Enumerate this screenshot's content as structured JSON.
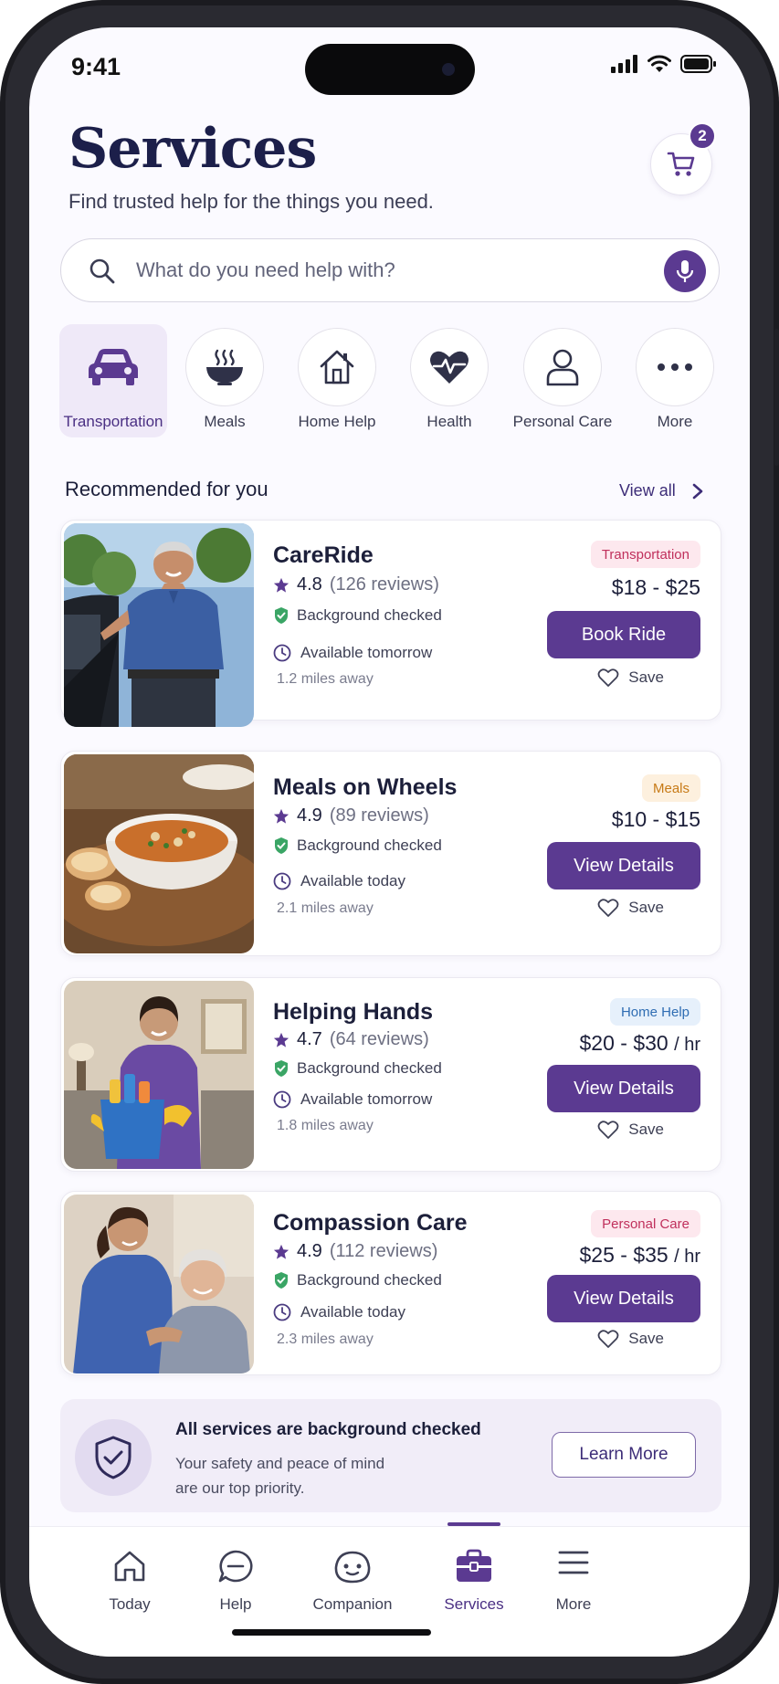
{
  "status_bar": {
    "time": "9:41"
  },
  "header": {
    "title": "Services",
    "subtitle": "Find trusted help for the things you need.",
    "cart_count": "2"
  },
  "search": {
    "placeholder": "What do you need help with?"
  },
  "categories": [
    {
      "label": "Transportation",
      "icon": "car-icon",
      "active": true
    },
    {
      "label": "Meals",
      "icon": "bowl-icon",
      "active": false
    },
    {
      "label": "Home Help",
      "icon": "house-icon",
      "active": false
    },
    {
      "label": "Health",
      "icon": "heart-pulse-icon",
      "active": false
    },
    {
      "label": "Personal Care",
      "icon": "person-icon",
      "active": false
    },
    {
      "label": "More",
      "icon": "ellipsis-icon",
      "active": false
    }
  ],
  "section": {
    "title": "Recommended for you",
    "view_all": "View all"
  },
  "cards": [
    {
      "name": "CareRide",
      "rating": "4.8",
      "reviews": "(126 reviews)",
      "background": "Background checked",
      "availability": "Available tomorrow",
      "distance": "1.2 miles away",
      "tag": "Transportation",
      "price": "$18 - $25",
      "cta": "Book Ride",
      "save": "Save",
      "tag_bg": "#fde8ee",
      "tag_color": "#c0305c"
    },
    {
      "name": "Meals on Wheels",
      "rating": "4.9",
      "reviews": "(89 reviews)",
      "background": "Background checked",
      "availability": "Available today",
      "distance": "2.1 miles away",
      "tag": "Meals",
      "price": "$10 - $15",
      "cta": "View Details",
      "save": "Save",
      "tag_bg": "#fdf0de",
      "tag_color": "#c77a16"
    },
    {
      "name": "Helping Hands",
      "rating": "4.7",
      "reviews": "(64 reviews)",
      "background": "Background checked",
      "availability": "Available tomorrow",
      "distance": "1.8 miles away",
      "tag": "Home Help",
      "price": "$20 - $30",
      "price_unit": "/ hr",
      "cta": "View Details",
      "save": "Save",
      "tag_bg": "#e6f0fb",
      "tag_color": "#2f6db3"
    },
    {
      "name": "Compassion Care",
      "rating": "4.9",
      "reviews": "(112 reviews)",
      "background": "Background checked",
      "availability": "Available today",
      "distance": "2.3 miles away",
      "tag": "Personal Care",
      "price": "$25 - $35",
      "price_unit": "/ hr",
      "cta": "View Details",
      "save": "Save",
      "tag_bg": "#fde8ee",
      "tag_color": "#c0305c"
    }
  ],
  "banner": {
    "title": "All services are background checked",
    "line1": "Your safety and peace of mind",
    "line2": "are our top priority.",
    "button": "Learn More"
  },
  "tabs": [
    {
      "label": "Today",
      "icon": "home-icon",
      "active": false
    },
    {
      "label": "Help",
      "icon": "chat-icon",
      "active": false
    },
    {
      "label": "Companion",
      "icon": "companion-face-icon",
      "active": false
    },
    {
      "label": "Services",
      "icon": "briefcase-icon",
      "active": true
    },
    {
      "label": "More",
      "icon": "menu-icon",
      "active": false
    }
  ],
  "colors": {
    "accent": "#5b3a91",
    "title": "#1c1f4a",
    "check_green": "#3aa565",
    "star": "#5b3a91"
  }
}
